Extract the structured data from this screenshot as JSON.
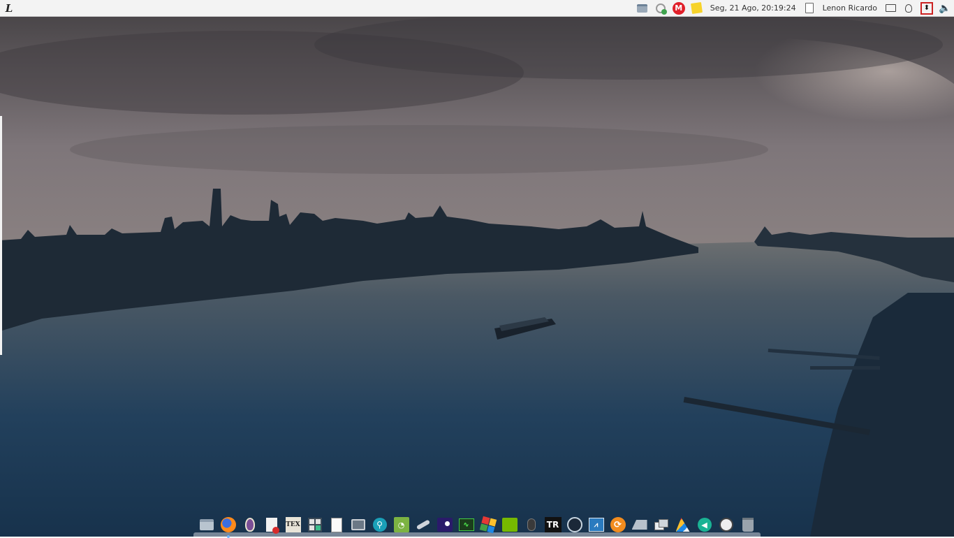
{
  "top_panel": {
    "launcher_glyph": "L",
    "datetime": "Seg, 21 Ago, 20:19:24",
    "username": "Lenon Ricardo",
    "tray_icons": [
      "folder-icon",
      "network-icon",
      "mega-icon",
      "sticky-note-icon",
      "clipboard-icon",
      "screen-icon",
      "bulb-icon",
      "updown-icon",
      "volume-icon"
    ],
    "mega_letter": "M"
  },
  "dock": {
    "items": [
      "files-icon",
      "firefox-icon",
      "tor-icon",
      "pdf-icon",
      "tex-icon",
      "calculator-icon",
      "document-icon",
      "screenshot-icon",
      "search-icon",
      "rss-icon",
      "telescope-icon",
      "stellarium-icon",
      "system-monitor-icon",
      "games-icon",
      "nvidia-icon",
      "mouse-icon",
      "torrent-icon",
      "steam-icon",
      "analyzer-icon",
      "update-icon",
      "drive-icon",
      "windows-icon",
      "pencils-icon",
      "audio-icon",
      "clock-icon",
      "trash-icon"
    ],
    "tex_label": "TEX",
    "torrent_label": "TR"
  },
  "colors": {
    "panel_bg": "#f3f3f3",
    "sky_top": "#4a4649",
    "horizon": "#f0a745",
    "water": "#1d3a56"
  }
}
